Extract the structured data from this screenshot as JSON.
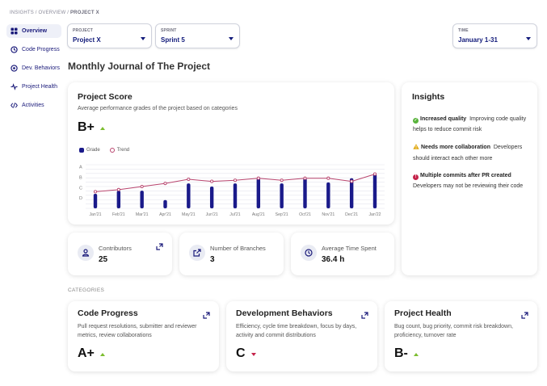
{
  "breadcrumb": {
    "path": "INSIGHTS / OVERVIEW / ",
    "current": "PROJECT X"
  },
  "nav": [
    {
      "label": "Overview",
      "icon": "grid-icon"
    },
    {
      "label": "Code Progress",
      "icon": "code-progress-icon"
    },
    {
      "label": "Dev. Behaviors",
      "icon": "behaviors-icon"
    },
    {
      "label": "Project Health",
      "icon": "heartbeat-icon"
    },
    {
      "label": "Activities",
      "icon": "code-icon"
    }
  ],
  "filters": {
    "project": {
      "label": "PROJECT",
      "value": "Project X"
    },
    "sprint": {
      "label": "SPRINT",
      "value": "Sprint 5"
    },
    "time": {
      "label": "TIME",
      "value": "January 1-31"
    }
  },
  "page_title": "Monthly Journal of The Project",
  "project_score": {
    "title": "Project Score",
    "subtitle": "Average performance grades of the project based on categories",
    "grade": "B+",
    "trend": "up"
  },
  "chart_data": {
    "type": "bar",
    "categories": [
      "Jan'21",
      "Feb'21",
      "Mar'21",
      "Apr'21",
      "May'21",
      "Jun'21",
      "Jul'21",
      "Aug'21",
      "Sep'21",
      "Oct'21",
      "Nov'21",
      "Dec'21",
      "Jan'22"
    ],
    "y_ticks": [
      "A",
      "B",
      "C",
      "D"
    ],
    "ylim": [
      0,
      4.2
    ],
    "series": [
      {
        "name": "Grade",
        "type": "bar",
        "values": [
          1.4,
          1.7,
          1.7,
          0.8,
          2.4,
          2.1,
          2.4,
          2.9,
          2.4,
          2.9,
          2.5,
          2.9,
          3.3
        ]
      },
      {
        "name": "Trend",
        "type": "line",
        "values": [
          1.6,
          1.8,
          2.1,
          2.4,
          2.8,
          2.6,
          2.7,
          2.9,
          2.7,
          2.9,
          2.9,
          2.6,
          3.3
        ]
      }
    ],
    "colors": {
      "bar": "#1a1a8a",
      "line": "#b9456e"
    },
    "grid": true,
    "legend_position": "top-left"
  },
  "insights": {
    "title": "Insights",
    "items": [
      {
        "bold": "Increased quality",
        "text": "Improving code quality helps to reduce commit risk",
        "bg": "#eaf6e3",
        "icon": "check-circle-icon",
        "color": "#58b33b"
      },
      {
        "bold": "Needs more collaboration",
        "text": "Developers should interact each other more",
        "bg": "#fdf7e1",
        "icon": "warning-icon",
        "color": "#e0a810"
      },
      {
        "bold": "Multiple commits after PR created",
        "text": "Developers may not be reviewing their code",
        "bg": "#fce7ea",
        "icon": "alert-circle-icon",
        "color": "#c4234a"
      }
    ]
  },
  "stats": [
    {
      "label": "Contributors",
      "value": "25",
      "icon": "user-icon"
    },
    {
      "label": "Number of Branches",
      "value": "3",
      "icon": "external-link-icon"
    },
    {
      "label": "Average Time Spent",
      "value": "36.4 h",
      "icon": "clock-icon"
    }
  ],
  "categories_label": "CATEGORIES",
  "categories": [
    {
      "title": "Code Progress",
      "desc": "Pull request resolutions, submitter and reviewer metrics, review collaborations",
      "grade": "A+",
      "trend": "up"
    },
    {
      "title": "Development Behaviors",
      "desc": "Efficiency, cycle time breakdown, focus by days, activity and commit distributions",
      "grade": "C",
      "trend": "down"
    },
    {
      "title": "Project Health",
      "desc": "Bug count, bug priority, commit risk breakdown, proficiency, turnover rate",
      "grade": "B-",
      "trend": "up"
    }
  ]
}
